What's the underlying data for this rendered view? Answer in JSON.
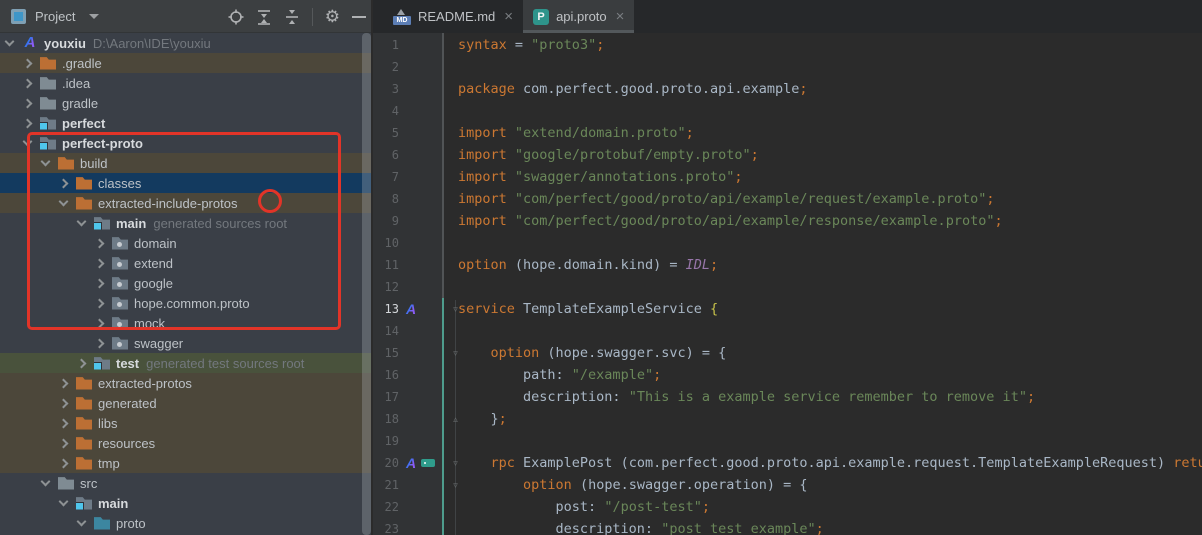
{
  "panel": {
    "title": "Project",
    "toolbar": [
      "locate",
      "expand-all",
      "collapse-all",
      "settings",
      "hide"
    ],
    "tree": [
      {
        "name": "youxiu",
        "suffix": "D:\\Aaron\\IDE\\youxiu",
        "icon": "logo",
        "bold": true,
        "indent": 0,
        "chevron": "down",
        "bg": "normal"
      },
      {
        "name": ".gradle",
        "icon": "folder-orange",
        "indent": 1,
        "chevron": "right",
        "bg": "brown"
      },
      {
        "name": ".idea",
        "icon": "folder-gray",
        "indent": 1,
        "chevron": "right",
        "bg": "normal"
      },
      {
        "name": "gradle",
        "icon": "folder-gray",
        "indent": 1,
        "chevron": "right",
        "bg": "normal"
      },
      {
        "name": "perfect",
        "icon": "module",
        "bold": true,
        "indent": 1,
        "chevron": "right",
        "bg": "normal"
      },
      {
        "name": "perfect-proto",
        "icon": "module",
        "bold": true,
        "indent": 1,
        "chevron": "down",
        "bg": "normal"
      },
      {
        "name": "build",
        "icon": "folder-orange",
        "indent": 2,
        "chevron": "down",
        "bg": "brown"
      },
      {
        "name": "classes",
        "icon": "folder-orange",
        "indent": 3,
        "chevron": "right",
        "bg": "selected"
      },
      {
        "name": "extracted-include-protos",
        "icon": "folder-orange",
        "indent": 3,
        "chevron": "down",
        "bg": "brown"
      },
      {
        "name": "main",
        "note": "generated sources root",
        "icon": "module",
        "bold": true,
        "indent": 4,
        "chevron": "down",
        "bg": "normal"
      },
      {
        "name": "domain",
        "icon": "folder-package",
        "indent": 5,
        "chevron": "right",
        "bg": "normal"
      },
      {
        "name": "extend",
        "icon": "folder-package",
        "indent": 5,
        "chevron": "right",
        "bg": "normal"
      },
      {
        "name": "google",
        "icon": "folder-package",
        "indent": 5,
        "chevron": "right",
        "bg": "normal"
      },
      {
        "name": "hope.common.proto",
        "icon": "folder-package",
        "indent": 5,
        "chevron": "right",
        "bg": "normal"
      },
      {
        "name": "mock",
        "icon": "folder-package",
        "indent": 5,
        "chevron": "right",
        "bg": "normal"
      },
      {
        "name": "swagger",
        "icon": "folder-package",
        "indent": 5,
        "chevron": "right",
        "bg": "normal"
      },
      {
        "name": "test",
        "note": "generated test sources root",
        "icon": "module",
        "bold": true,
        "indent": 4,
        "chevron": "right",
        "bg": "green"
      },
      {
        "name": "extracted-protos",
        "icon": "folder-orange",
        "indent": 3,
        "chevron": "right",
        "bg": "brown"
      },
      {
        "name": "generated",
        "icon": "folder-orange",
        "indent": 3,
        "chevron": "right",
        "bg": "brown"
      },
      {
        "name": "libs",
        "icon": "folder-orange",
        "indent": 3,
        "chevron": "right",
        "bg": "brown"
      },
      {
        "name": "resources",
        "icon": "folder-orange",
        "indent": 3,
        "chevron": "right",
        "bg": "brown"
      },
      {
        "name": "tmp",
        "icon": "folder-orange",
        "indent": 3,
        "chevron": "right",
        "bg": "brown"
      },
      {
        "name": "src",
        "icon": "folder-gray",
        "indent": 2,
        "chevron": "down",
        "bg": "normal"
      },
      {
        "name": "main",
        "icon": "module",
        "bold": true,
        "indent": 3,
        "chevron": "down",
        "bg": "normal"
      },
      {
        "name": "proto",
        "icon": "folder-teal",
        "indent": 4,
        "chevron": "down",
        "bg": "normal"
      }
    ]
  },
  "tabs": [
    {
      "label": "README.md",
      "icon": "markdown-icon",
      "close": "×",
      "active": false
    },
    {
      "label": "api.proto",
      "icon": "proto-icon",
      "close": "×",
      "active": true
    }
  ],
  "editor": {
    "active_line": 13,
    "lines": [
      {
        "n": 1,
        "segs": [
          [
            "kw",
            "syntax"
          ],
          [
            "pl",
            " = "
          ],
          [
            "str",
            "\"proto3\""
          ],
          [
            "sc",
            ";"
          ]
        ]
      },
      {
        "n": 2,
        "segs": []
      },
      {
        "n": 3,
        "segs": [
          [
            "kw",
            "package"
          ],
          [
            "pl",
            " com.perfect.good.proto.api.example"
          ],
          [
            "sc",
            ";"
          ]
        ]
      },
      {
        "n": 4,
        "segs": []
      },
      {
        "n": 5,
        "segs": [
          [
            "kw",
            "import"
          ],
          [
            "pl",
            " "
          ],
          [
            "str",
            "\"extend/domain.proto\""
          ],
          [
            "sc",
            ";"
          ]
        ]
      },
      {
        "n": 6,
        "segs": [
          [
            "kw",
            "import"
          ],
          [
            "pl",
            " "
          ],
          [
            "str",
            "\"google/protobuf/empty.proto\""
          ],
          [
            "sc",
            ";"
          ]
        ]
      },
      {
        "n": 7,
        "segs": [
          [
            "kw",
            "import"
          ],
          [
            "pl",
            " "
          ],
          [
            "str",
            "\"swagger/annotations.proto\""
          ],
          [
            "sc",
            ";"
          ]
        ]
      },
      {
        "n": 8,
        "segs": [
          [
            "kw",
            "import"
          ],
          [
            "pl",
            " "
          ],
          [
            "str",
            "\"com/perfect/good/proto/api/example/request/example.proto\""
          ],
          [
            "sc",
            ";"
          ]
        ]
      },
      {
        "n": 9,
        "segs": [
          [
            "kw",
            "import"
          ],
          [
            "pl",
            " "
          ],
          [
            "str",
            "\"com/perfect/good/proto/api/example/response/example.proto\""
          ],
          [
            "sc",
            ";"
          ]
        ]
      },
      {
        "n": 10,
        "segs": []
      },
      {
        "n": 11,
        "segs": [
          [
            "kw",
            "option"
          ],
          [
            "pl",
            " (hope.domain.kind) = "
          ],
          [
            "it",
            "IDL"
          ],
          [
            "sc",
            ";"
          ]
        ]
      },
      {
        "n": 12,
        "segs": []
      },
      {
        "n": 13,
        "segs": [
          [
            "kw",
            "service"
          ],
          [
            "pl",
            " TemplateExampleService "
          ],
          [
            "br",
            "{"
          ]
        ],
        "gut": [
          "logo"
        ],
        "fold": "open"
      },
      {
        "n": 14,
        "segs": []
      },
      {
        "n": 15,
        "segs": [
          [
            "pl",
            "    "
          ],
          [
            "kw",
            "option"
          ],
          [
            "pl",
            " (hope.swagger.svc) = {"
          ]
        ],
        "fold": "open"
      },
      {
        "n": 16,
        "segs": [
          [
            "pl",
            "        path: "
          ],
          [
            "str",
            "\"/example\""
          ],
          [
            "sc",
            ";"
          ]
        ]
      },
      {
        "n": 17,
        "segs": [
          [
            "pl",
            "        description: "
          ],
          [
            "str",
            "\"This is a example service remember to remove it\""
          ],
          [
            "sc",
            ";"
          ]
        ]
      },
      {
        "n": 18,
        "segs": [
          [
            "pl",
            "    }"
          ],
          [
            "sc",
            ";"
          ]
        ],
        "fold": "close"
      },
      {
        "n": 19,
        "segs": []
      },
      {
        "n": 20,
        "segs": [
          [
            "pl",
            "    "
          ],
          [
            "kw",
            "rpc"
          ],
          [
            "pl",
            " ExamplePost (com.perfect.good.proto.api.example.request.TemplateExampleRequest) "
          ],
          [
            "kw",
            "returns"
          ]
        ],
        "gut": [
          "logo",
          "api"
        ],
        "fold": "open"
      },
      {
        "n": 21,
        "segs": [
          [
            "pl",
            "        "
          ],
          [
            "kw",
            "option"
          ],
          [
            "pl",
            " (hope.swagger.operation) = {"
          ]
        ],
        "fold": "open"
      },
      {
        "n": 22,
        "segs": [
          [
            "pl",
            "            post: "
          ],
          [
            "str",
            "\"/post-test\""
          ],
          [
            "sc",
            ";"
          ]
        ]
      },
      {
        "n": 23,
        "segs": [
          [
            "pl",
            "            description: "
          ],
          [
            "str",
            "\"post test example\""
          ],
          [
            "sc",
            ";"
          ]
        ]
      }
    ]
  },
  "colors": {
    "keyword": "#CC7832",
    "string": "#6A8759",
    "plain_text": "#A9B7C6",
    "constant": "#9876AA",
    "editor_bg": "#2B2B2B",
    "gutter_bg": "#313335",
    "tree_bg": "#3A3F47",
    "row_brown": "#4C473A",
    "row_selected": "#133A5F",
    "row_green": "#49523C",
    "folder_orange": "#BC6F34",
    "folder_gray": "#7F8B93",
    "folder_teal": "#3C86A0",
    "module_badge": "#4FC6EC",
    "proto_tab_icon": "#2E948B",
    "vcs_added": "#4E9C8C",
    "annotation_red": "#E23428"
  }
}
